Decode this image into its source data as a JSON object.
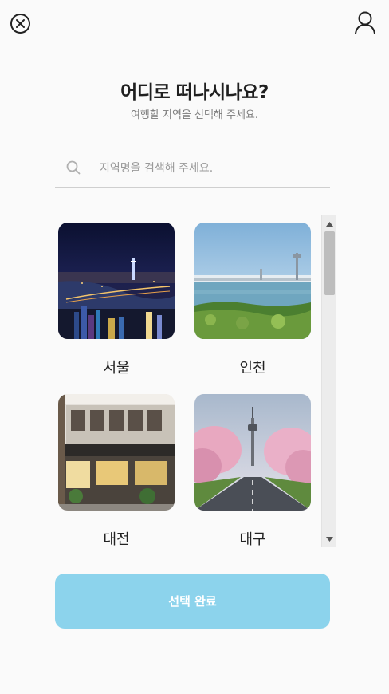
{
  "header": {
    "close_icon": "close-circle-icon",
    "user_icon": "user-icon"
  },
  "title": "어디로 떠나시나요?",
  "subtitle": "여행할 지역을 선택해 주세요.",
  "search": {
    "icon": "search-icon",
    "placeholder": "지역명을 검색해 주세요.",
    "value": ""
  },
  "regions": [
    {
      "label": "서울",
      "image": "seoul-night-skyline"
    },
    {
      "label": "인천",
      "image": "incheon-bridge-sea"
    },
    {
      "label": "대전",
      "image": "daejeon-storefront"
    },
    {
      "label": "대구",
      "image": "daegu-tower-cherry-blossom-road"
    }
  ],
  "colors": {
    "primary_button": "#8cd3ec",
    "background": "#fafafa"
  },
  "footer": {
    "done_label": "선택 완료"
  }
}
